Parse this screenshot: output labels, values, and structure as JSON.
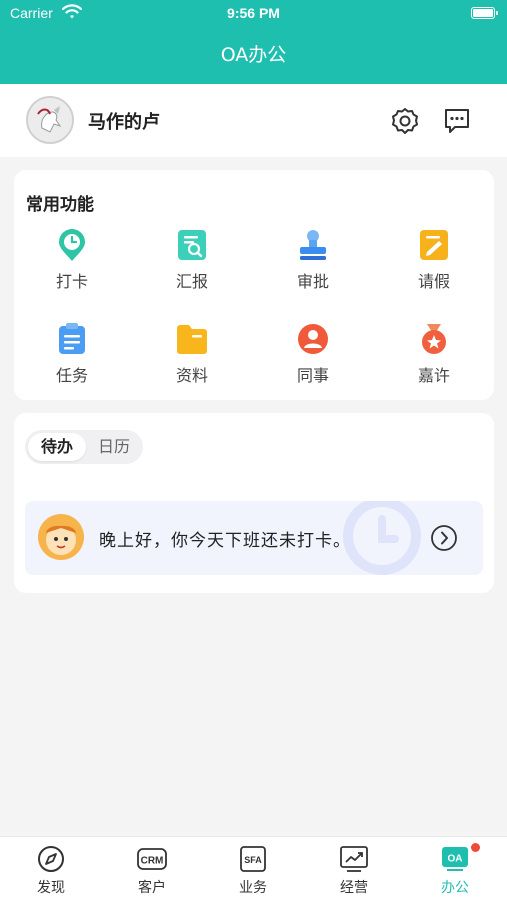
{
  "status": {
    "carrier": "Carrier",
    "time": "9:56 PM"
  },
  "header": {
    "title": "OA办公"
  },
  "user": {
    "name": "马作的卢"
  },
  "functions": {
    "title": "常用功能",
    "items": [
      {
        "label": "打卡",
        "icon": "clock-pin-icon",
        "color": "#2ec4a5"
      },
      {
        "label": "汇报",
        "icon": "report-search-icon",
        "color": "#3ccfb9"
      },
      {
        "label": "审批",
        "icon": "approval-stamp-icon",
        "color": "#3a8ef0"
      },
      {
        "label": "请假",
        "icon": "leave-note-icon",
        "color": "#f7b21b"
      },
      {
        "label": "任务",
        "icon": "task-clipboard-icon",
        "color": "#4a9df2"
      },
      {
        "label": "资料",
        "icon": "folder-icon",
        "color": "#f8b61c"
      },
      {
        "label": "同事",
        "icon": "colleague-icon",
        "color": "#f05a3a"
      },
      {
        "label": "嘉许",
        "icon": "medal-icon",
        "color": "#f0603e"
      }
    ]
  },
  "todo": {
    "tabs": [
      "待办",
      "日历"
    ],
    "notice": "晚上好，你今天下班还未打卡。"
  },
  "tabbar": {
    "items": [
      {
        "label": "发现",
        "icon": "compass-icon"
      },
      {
        "label": "客户",
        "icon": "crm-icon",
        "text": "CRM"
      },
      {
        "label": "业务",
        "icon": "sfa-icon",
        "text": "SFA"
      },
      {
        "label": "经营",
        "icon": "trend-chart-icon"
      },
      {
        "label": "办公",
        "icon": "oa-icon",
        "text": "OA"
      }
    ],
    "active_color": "#1fbfb0"
  }
}
